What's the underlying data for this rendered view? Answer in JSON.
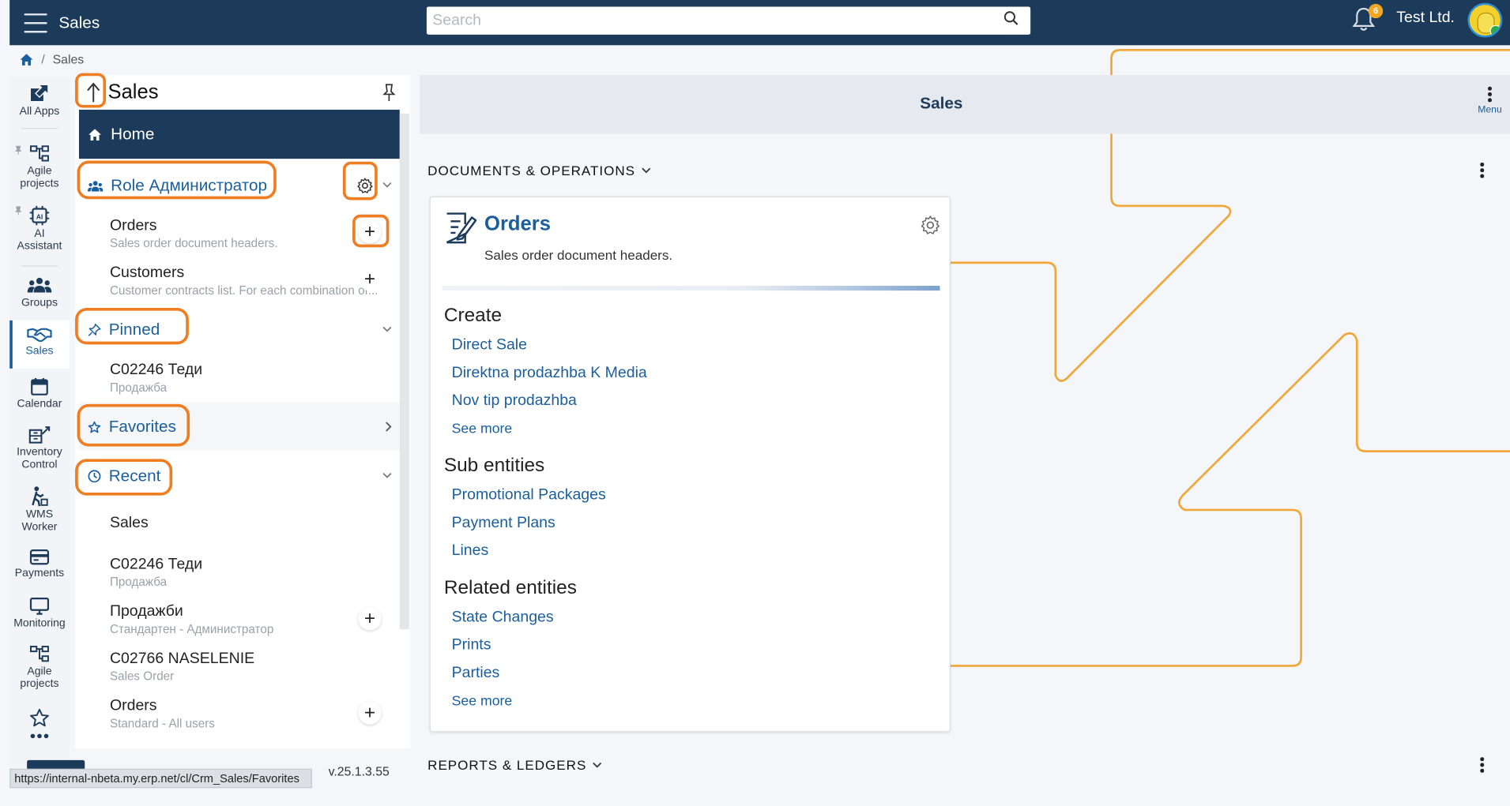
{
  "topbar": {
    "app_title": "Sales",
    "search_placeholder": "Search",
    "notifications_count": "6",
    "company": "Test Ltd."
  },
  "breadcrumb": {
    "current": "Sales"
  },
  "rail": {
    "items": [
      {
        "label": "All Apps",
        "icon": "external-link-icon"
      },
      {
        "label": "Agile projects",
        "icon": "hierarchy-icon"
      },
      {
        "label": "AI Assistant",
        "icon": "ai-chip-icon"
      },
      {
        "label": "Groups",
        "icon": "groups-icon"
      },
      {
        "label": "Sales",
        "icon": "handshake-icon",
        "active": true
      },
      {
        "label": "Calendar",
        "icon": "calendar-icon"
      },
      {
        "label": "Inventory Control",
        "icon": "inventory-icon"
      },
      {
        "label": "WMS Worker",
        "icon": "worker-icon"
      },
      {
        "label": "Payments",
        "icon": "card-icon"
      },
      {
        "label": "Monitoring",
        "icon": "monitor-icon"
      },
      {
        "label": "Agile projects",
        "icon": "hierarchy-icon"
      }
    ]
  },
  "nav": {
    "title": "Sales",
    "home": "Home",
    "role": "Role Администратор",
    "role_items": [
      {
        "title": "Orders",
        "subtitle": "Sales order document headers."
      },
      {
        "title": "Customers",
        "subtitle": "Customer contracts list. For each combination of..."
      }
    ],
    "pinned": "Pinned",
    "pinned_items": [
      {
        "title": "C02246 Теди",
        "subtitle": "Продажба"
      }
    ],
    "favorites": "Favorites",
    "recent": "Recent",
    "recent_items": [
      {
        "title": "Sales",
        "subtitle": ""
      },
      {
        "title": "C02246 Теди",
        "subtitle": "Продажба"
      },
      {
        "title": "Продажби",
        "subtitle": "Стандартен - Администратор"
      },
      {
        "title": "C02766 NASELENIE",
        "subtitle": "Sales Order"
      },
      {
        "title": "Orders",
        "subtitle": "Standard - All users"
      }
    ],
    "version": "v.25.1.3.55",
    "status_url": "https://internal-nbeta.my.erp.net/cl/Crm_Sales/Favorites"
  },
  "main": {
    "title": "Sales",
    "menu_label": "Menu",
    "section1": "DOCUMENTS & OPERATIONS",
    "section2": "REPORTS & LEDGERS",
    "card": {
      "title": "Orders",
      "subtitle": "Sales order document headers.",
      "create_title": "Create",
      "create_links": [
        "Direct Sale",
        "Direktna prodazhba K Media",
        "Nov tip prodazhba"
      ],
      "create_more": "See more",
      "sub_title": "Sub entities",
      "sub_links": [
        "Promotional Packages",
        "Payment Plans",
        "Lines"
      ],
      "related_title": "Related entities",
      "related_links": [
        "State Changes",
        "Prints",
        "Parties"
      ],
      "related_more": "See more"
    }
  },
  "colors": {
    "topbar": "#1c3a5a",
    "accent": "#1a5e9c",
    "highlight": "#ef7d22",
    "notification_badge": "#f5a623"
  }
}
